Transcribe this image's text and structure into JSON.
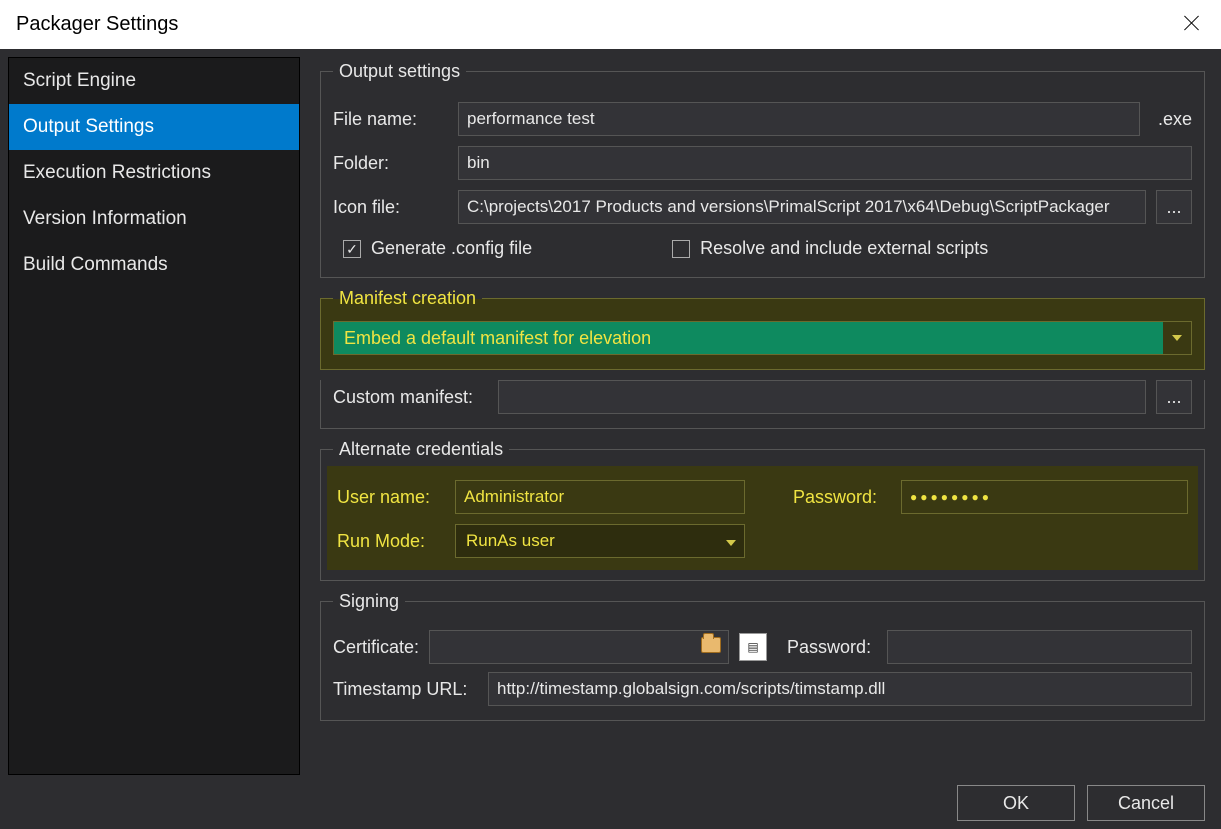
{
  "title": "Packager Settings",
  "sidebar": {
    "items": [
      {
        "label": "Script Engine"
      },
      {
        "label": "Output Settings"
      },
      {
        "label": "Execution Restrictions"
      },
      {
        "label": "Version Information"
      },
      {
        "label": "Build Commands"
      }
    ],
    "selected_index": 1
  },
  "output_settings": {
    "legend": "Output settings",
    "file_name_label": "File name:",
    "file_name_value": "performance test",
    "file_name_suffix": ".exe",
    "folder_label": "Folder:",
    "folder_value": "bin",
    "icon_file_label": "Icon file:",
    "icon_file_value": "C:\\projects\\2017 Products and versions\\PrimalScript 2017\\x64\\Debug\\ScriptPackager",
    "browse_label": "...",
    "generate_config_label": "Generate .config file",
    "generate_config_checked": true,
    "resolve_scripts_label": "Resolve and include external scripts",
    "resolve_scripts_checked": false
  },
  "manifest": {
    "legend": "Manifest creation",
    "dropdown_value": "Embed a default manifest for elevation",
    "custom_label": "Custom manifest:",
    "custom_value": "",
    "browse_label": "..."
  },
  "credentials": {
    "legend": "Alternate credentials",
    "username_label": "User name:",
    "username_value": "Administrator",
    "password_label": "Password:",
    "password_value": "●●●●●●●●",
    "runmode_label": "Run Mode:",
    "runmode_value": "RunAs user"
  },
  "signing": {
    "legend": "Signing",
    "certificate_label": "Certificate:",
    "certificate_value": "",
    "password_label": "Password:",
    "password_value": "",
    "timestamp_label": "Timestamp URL:",
    "timestamp_value": "http://timestamp.globalsign.com/scripts/timstamp.dll"
  },
  "footer": {
    "ok": "OK",
    "cancel": "Cancel"
  }
}
